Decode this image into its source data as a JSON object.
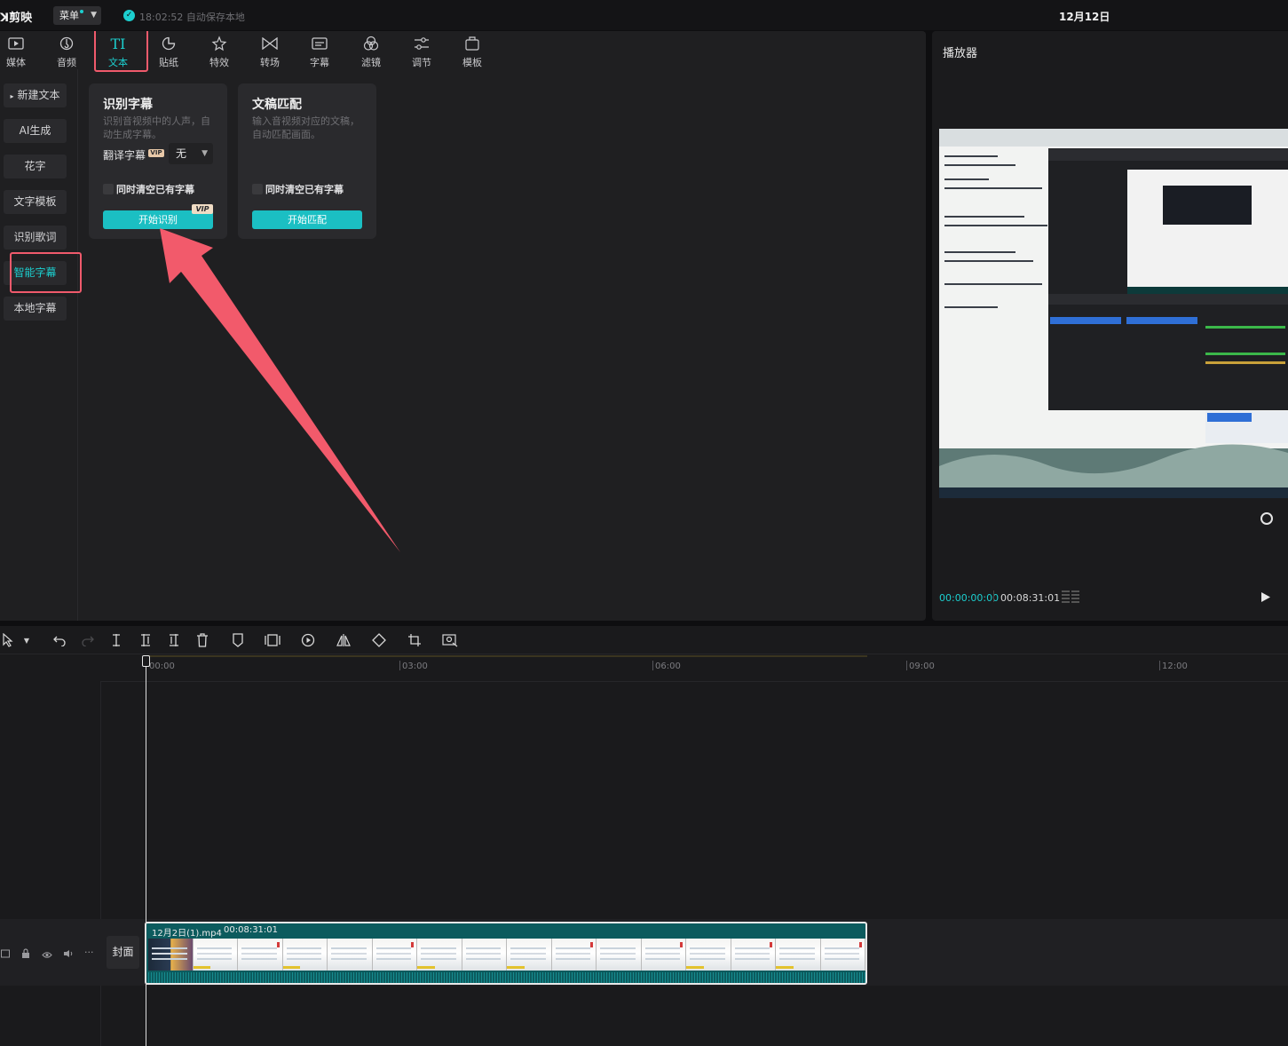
{
  "titlebar": {
    "app_name": "剪映",
    "menu_label": "菜单",
    "save_status": "18:02:52 自动保存本地",
    "date": "12月12日"
  },
  "toolbar": {
    "tabs": [
      {
        "label": "媒体",
        "icon": "media-icon"
      },
      {
        "label": "音频",
        "icon": "audio-icon"
      },
      {
        "label": "文本",
        "icon": "text-icon"
      },
      {
        "label": "贴纸",
        "icon": "sticker-icon"
      },
      {
        "label": "特效",
        "icon": "effects-icon"
      },
      {
        "label": "转场",
        "icon": "transition-icon"
      },
      {
        "label": "字幕",
        "icon": "subtitle-icon"
      },
      {
        "label": "滤镜",
        "icon": "filter-icon"
      },
      {
        "label": "调节",
        "icon": "adjust-icon"
      },
      {
        "label": "模板",
        "icon": "template-icon"
      }
    ],
    "active_tab": "文本",
    "accent_color": "#1ccfcf",
    "highlight_color": "#f05a6c"
  },
  "side_nav": {
    "items": [
      {
        "label": "新建文本"
      },
      {
        "label": "AI生成"
      },
      {
        "label": "花字"
      },
      {
        "label": "文字模板"
      },
      {
        "label": "识别歌词"
      },
      {
        "label": "智能字幕"
      },
      {
        "label": "本地字幕"
      }
    ],
    "active_item": "智能字幕"
  },
  "cards": {
    "recognize": {
      "title": "识别字幕",
      "description": "识别音视频中的人声，自动生成字幕。",
      "translate_label": "翻译字幕",
      "translate_vip": "VIP",
      "translate_value": "无",
      "clear_label": "同时清空已有字幕",
      "button_label": "开始识别",
      "button_vip": "VIP"
    },
    "match": {
      "title": "文稿匹配",
      "description": "输入音视频对应的文稿，自动匹配画面。",
      "clear_label": "同时清空已有字幕",
      "button_label": "开始匹配"
    }
  },
  "player": {
    "title": "播放器",
    "current_time": "00:00:00:00",
    "total_time": "00:08:31:01"
  },
  "timeline": {
    "ruler_ticks": [
      "00:00",
      "03:00",
      "06:00",
      "09:00",
      "12:00"
    ],
    "cover_label": "封面",
    "clip": {
      "name": "12月2日(1).mp4",
      "duration": "00:08:31:01"
    }
  }
}
